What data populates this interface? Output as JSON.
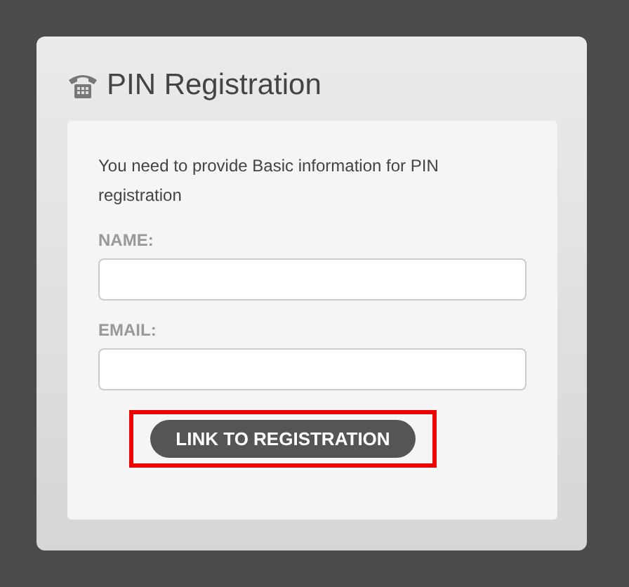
{
  "panel": {
    "title": "PIN Registration"
  },
  "intro": "You need to provide Basic information for PIN registration",
  "fields": [
    {
      "label": "NAME:"
    },
    {
      "label": "EMAIL:"
    }
  ],
  "button": {
    "label": "LINK TO REGISTRATION",
    "highlighted": true
  }
}
